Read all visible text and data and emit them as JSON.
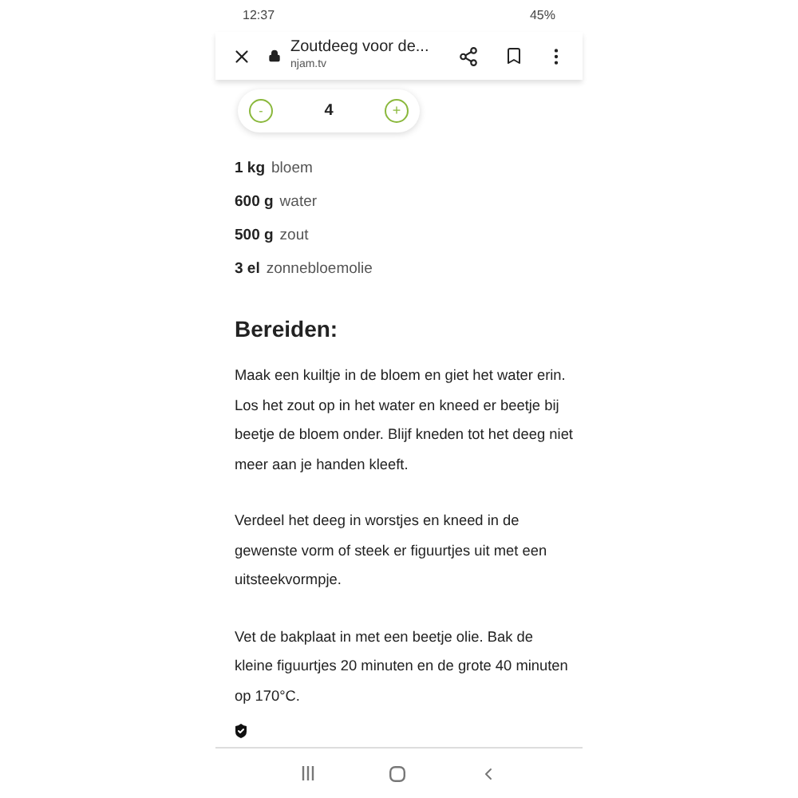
{
  "status_bar": {
    "time": "12:37",
    "battery": "45%"
  },
  "toolbar": {
    "title": "Zoutdeeg voor de...",
    "url": "njam.tv"
  },
  "servings": {
    "minus": "-",
    "count": "4",
    "plus": "+"
  },
  "ingredients": [
    {
      "amount": "1 kg",
      "name": "bloem"
    },
    {
      "amount": "600 g",
      "name": "water"
    },
    {
      "amount": "500 g",
      "name": "zout"
    },
    {
      "amount": "3 el",
      "name": "zonnebloemolie"
    }
  ],
  "heading": "Bereiden:",
  "steps": [
    "Maak een kuiltje in de bloem en giet het water erin. Los het zout op in het water en kneed er beetje bij beetje de bloem onder. Blijf kneden tot het deeg niet meer aan je handen kleeft.",
    "Verdeel het deeg in worstjes en kneed in de gewenste vorm of steek er figuurtjes uit met een uitsteekvormpje.",
    "Vet de bakplaat in met een beetje olie. Bak de kleine figuurtjes 20 minuten en de grote 40 minuten op 170°C."
  ]
}
